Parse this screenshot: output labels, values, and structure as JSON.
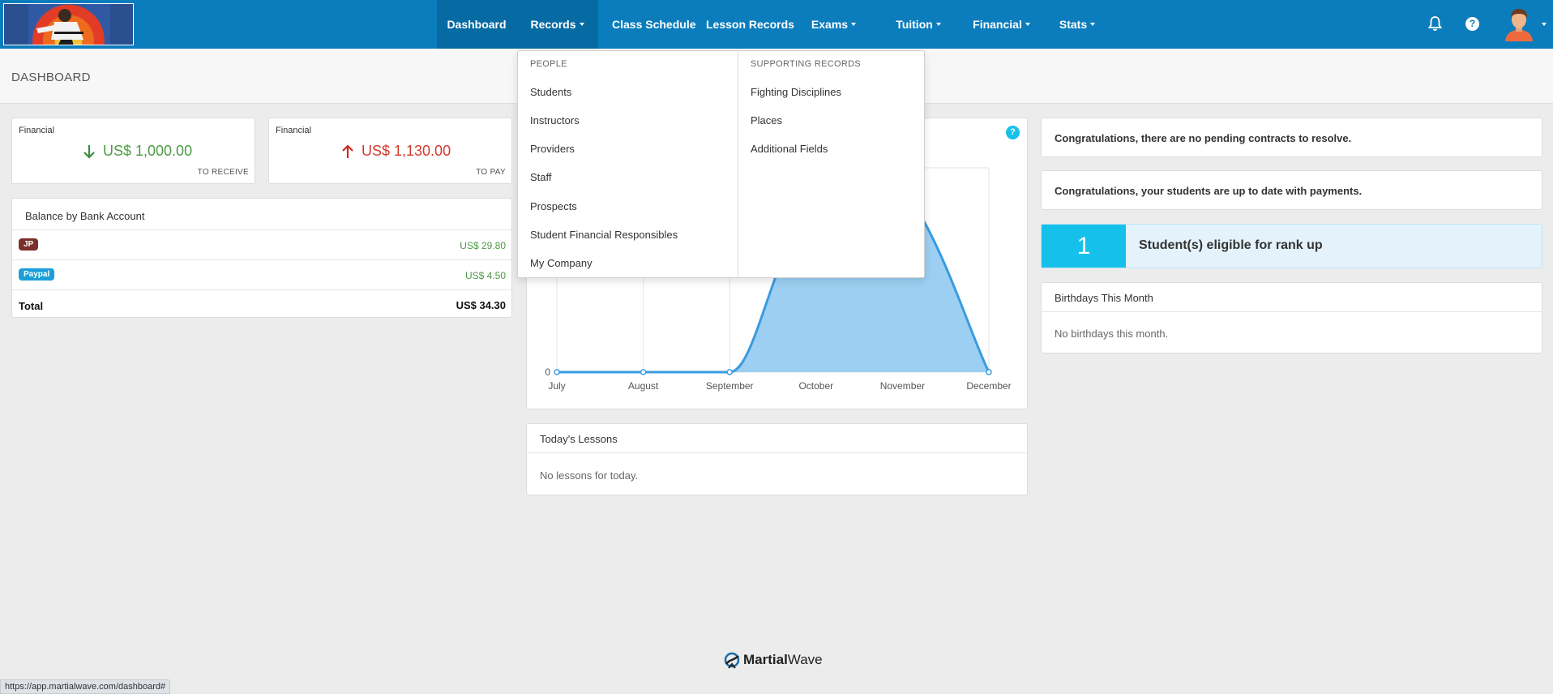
{
  "nav": {
    "items": [
      {
        "label": "Dashboard",
        "dropdown": false
      },
      {
        "label": "Records",
        "dropdown": true
      },
      {
        "label": "Class Schedule",
        "dropdown": false
      },
      {
        "label": "Lesson Records",
        "dropdown": false
      },
      {
        "label": "Exams",
        "dropdown": true
      },
      {
        "label": "Tuition",
        "dropdown": true
      },
      {
        "label": "Financial",
        "dropdown": true
      },
      {
        "label": "Stats",
        "dropdown": true
      }
    ],
    "help_glyph": "?",
    "icons": [
      "bell-icon",
      "question-icon",
      "avatar"
    ]
  },
  "page": {
    "title": "DASHBOARD"
  },
  "financial_receive": {
    "label": "Financial",
    "amount": "US$ 1,000.00",
    "sub": "TO RECEIVE"
  },
  "financial_pay": {
    "label": "Financial",
    "amount": "US$ 1,130.00",
    "sub": "TO PAY"
  },
  "balance": {
    "title": "Balance by Bank Account",
    "rows": [
      {
        "badge": "JP",
        "badge_color": "#7a2f2a",
        "value": "US$ 29.80"
      },
      {
        "badge": "Paypal",
        "badge_color": "#1a9fd9",
        "value": "US$ 4.50"
      }
    ],
    "total_label": "Total",
    "total_value": "US$ 34.30"
  },
  "chart_data": {
    "type": "area",
    "categories": [
      "July",
      "August",
      "September",
      "October",
      "November",
      "December"
    ],
    "values": [
      0,
      0,
      0,
      null,
      null,
      0
    ],
    "y_tick_labels": [
      "0"
    ],
    "grid": true,
    "fill_color": "#9ccff2",
    "line_color": "#3a9be0",
    "note": ""
  },
  "lessons": {
    "title": "Today's Lessons",
    "empty": "No lessons for today."
  },
  "alerts": {
    "contracts": "Congratulations, there are no pending contracts to resolve.",
    "payments": "Congratulations, your students are up to date with payments."
  },
  "rank": {
    "count": "1",
    "text": "Student(s) eligible for rank up"
  },
  "birthdays": {
    "title": "Birthdays This Month",
    "empty": "No birthdays this month."
  },
  "dropdown": {
    "people_heading": "PEOPLE",
    "people": [
      "Students",
      "Instructors",
      "Providers",
      "Staff",
      "Prospects",
      "Student Financial Responsibles",
      "My Company"
    ],
    "supporting_heading": "SUPPORTING RECORDS",
    "supporting": [
      "Fighting Disciplines",
      "Places",
      "Additional Fields"
    ]
  },
  "footer": {
    "brand_bold": "Martial",
    "brand_rest": "Wave"
  },
  "status_url": "https://app.martialwave.com/dashboard#"
}
